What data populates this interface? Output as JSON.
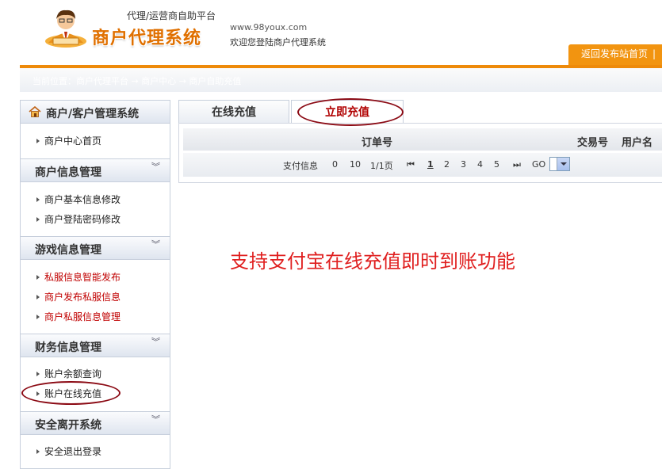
{
  "header": {
    "tagline": "代理/运营商自助平台",
    "brand": "商户代理系统",
    "site_url": "www.98youx.com",
    "welcome": "欢迎您登陆商户代理系统",
    "top_link": "返回发布站首页",
    "top_link_sep": "|"
  },
  "breadcrumb": "当前位置：商户代理平台 → 商户中心 → 商户自助充值",
  "sidebar": {
    "sections": [
      {
        "title": "商户/客户管理系统",
        "icon": "home-icon",
        "items": [
          {
            "label": "商户中心首页",
            "highlight": false
          }
        ]
      },
      {
        "title": "商户信息管理",
        "icon": "chevron-down-icon",
        "items": [
          {
            "label": "商户基本信息修改",
            "highlight": false
          },
          {
            "label": "商户登陆密码修改",
            "highlight": false
          }
        ]
      },
      {
        "title": "游戏信息管理",
        "icon": "chevron-down-icon",
        "items": [
          {
            "label": "私服信息智能发布",
            "highlight": true
          },
          {
            "label": "商户发布私服信息",
            "highlight": true
          },
          {
            "label": "商户私服信息管理",
            "highlight": true
          }
        ]
      },
      {
        "title": "财务信息管理",
        "icon": "chevron-down-icon",
        "items": [
          {
            "label": "账户余额查询",
            "highlight": false
          },
          {
            "label": "账户在线充值",
            "highlight": false
          }
        ]
      },
      {
        "title": "安全离开系统",
        "icon": "chevron-down-icon",
        "items": [
          {
            "label": "安全退出登录",
            "highlight": false
          }
        ]
      }
    ]
  },
  "tabs": [
    {
      "label": "在线充值",
      "active": false
    },
    {
      "label": "立即充值",
      "active": true
    }
  ],
  "table": {
    "columns": [
      "订单号",
      "交易号",
      "用户名"
    ]
  },
  "pager": {
    "label": "支付信息",
    "total": "0",
    "page_size": "10",
    "page_info": "1/1页",
    "first": "⏮",
    "pages": [
      "1",
      "2",
      "3",
      "4",
      "5"
    ],
    "current_page": "1",
    "last": "⏭",
    "go": "GO"
  },
  "annotation": "支持支付宝在线充值即时到账功能",
  "colors": {
    "accent": "#ee8a0a",
    "brand": "#e07000",
    "highlight_text": "#c00000",
    "annotation": "#e02020",
    "oval": "#8b0a14"
  }
}
